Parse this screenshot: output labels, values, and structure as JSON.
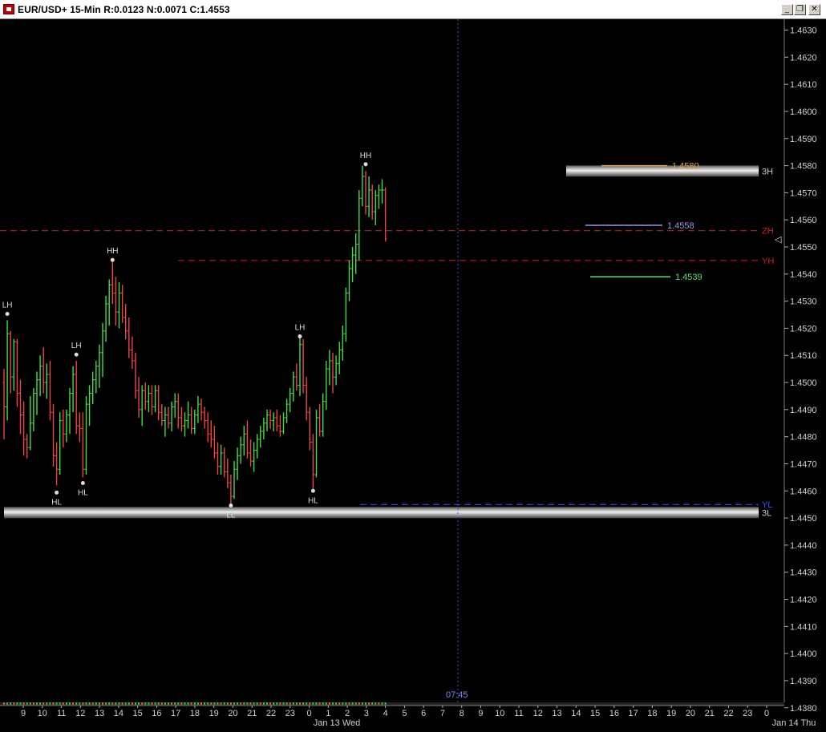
{
  "window": {
    "title": "EUR/USD+ 15-Min R:0.0123 N:0.0071 C:1.4553",
    "minimize_glyph": "_",
    "restore_glyph": "❐",
    "close_glyph": "✕"
  },
  "chart_data": {
    "type": "bar",
    "title": "EUR/USD+ 15-Min R:0.0123 N:0.0071 C:1.4553",
    "bar_style": "OHLC",
    "colors": {
      "up": "#44dd44",
      "down": "#ee4444",
      "background": "#000000",
      "axis_text": "#d0d0d0"
    },
    "ylim": [
      1.4382,
      1.4634
    ],
    "y_ticks": [
      1.463,
      1.462,
      1.461,
      1.46,
      1.459,
      1.458,
      1.457,
      1.456,
      1.455,
      1.454,
      1.453,
      1.452,
      1.451,
      1.45,
      1.449,
      1.448,
      1.447,
      1.446,
      1.445,
      1.444,
      1.443,
      1.442,
      1.441,
      1.44,
      1.439,
      1.438
    ],
    "x_ticks": [
      "9",
      "10",
      "11",
      "12",
      "13",
      "14",
      "15",
      "16",
      "17",
      "18",
      "19",
      "20",
      "21",
      "22",
      "23",
      "0",
      "1",
      "2",
      "3",
      "4",
      "5",
      "6",
      "7",
      "8",
      "9",
      "10",
      "11",
      "12",
      "13",
      "14",
      "15",
      "16",
      "17",
      "18",
      "19",
      "20",
      "21",
      "22",
      "23",
      "0"
    ],
    "x_date_labels": [
      "Jan 13 Wed",
      "Jan 14 Thu"
    ],
    "cursor_time": "07:45",
    "pivot_labels": [
      {
        "text": "LH",
        "bar": 1,
        "price": 1.45253,
        "pos": "above"
      },
      {
        "text": "HL",
        "bar": 16,
        "price": 1.44594,
        "pos": "below"
      },
      {
        "text": "LH",
        "bar": 22,
        "price": 1.45103,
        "pos": "above"
      },
      {
        "text": "HL",
        "bar": 24,
        "price": 1.44629,
        "pos": "below"
      },
      {
        "text": "HH",
        "bar": 33,
        "price": 1.45452,
        "pos": "above"
      },
      {
        "text": "LL",
        "bar": 69,
        "price": 1.44546,
        "pos": "below"
      },
      {
        "text": "LH",
        "bar": 90,
        "price": 1.4517,
        "pos": "above"
      },
      {
        "text": "HL",
        "bar": 94,
        "price": 1.446,
        "pos": "below"
      },
      {
        "text": "HH",
        "bar": 110,
        "price": 1.45805,
        "pos": "above"
      }
    ],
    "levels": [
      {
        "label": "ZH",
        "price": 1.4556,
        "color": "#cc2222",
        "style": "dashed"
      },
      {
        "label": "YH",
        "price": 1.4545,
        "color": "#cc2222",
        "style": "dashed"
      },
      {
        "label": "YL",
        "price": 1.4455,
        "color": "#3355ff",
        "style": "dashed"
      }
    ],
    "bands": [
      {
        "label": "3H",
        "price": 1.4578
      },
      {
        "label": "3L",
        "price": 1.4452
      }
    ],
    "price_markers": [
      {
        "text": "1.4580",
        "price": 1.458,
        "color": "#e0a040"
      },
      {
        "text": "1.4558",
        "price": 1.4558,
        "color": "#9999ee"
      },
      {
        "text": "1.4539",
        "price": 1.4539,
        "color": "#66dd66"
      }
    ],
    "series": [
      {
        "values": [
          [
            1.45,
            1.4505,
            1.4479,
            1.4491
          ],
          [
            1.4491,
            1.4523,
            1.4486,
            1.4518
          ],
          [
            1.4518,
            1.4519,
            1.4496,
            1.4502
          ],
          [
            1.4502,
            1.4516,
            1.4497,
            1.4515
          ],
          [
            1.4515,
            1.4516,
            1.4491,
            1.4496
          ],
          [
            1.4496,
            1.4501,
            1.4481,
            1.4488
          ],
          [
            1.4488,
            1.4493,
            1.4473,
            1.4479
          ],
          [
            1.4479,
            1.4481,
            1.4472,
            1.4476
          ],
          [
            1.4476,
            1.4495,
            1.4475,
            1.4485
          ],
          [
            1.4485,
            1.4498,
            1.4482,
            1.4496
          ],
          [
            1.4496,
            1.4504,
            1.4488,
            1.4501
          ],
          [
            1.4501,
            1.451,
            1.4495,
            1.4506
          ],
          [
            1.4506,
            1.4513,
            1.4496,
            1.45
          ],
          [
            1.45,
            1.4507,
            1.4494,
            1.4503
          ],
          [
            1.4503,
            1.4508,
            1.4486,
            1.4489
          ],
          [
            1.4489,
            1.4492,
            1.4469,
            1.4473
          ],
          [
            1.4473,
            1.4478,
            1.4462,
            1.4468
          ],
          [
            1.4468,
            1.4489,
            1.4466,
            1.4486
          ],
          [
            1.4486,
            1.449,
            1.4476,
            1.4481
          ],
          [
            1.4481,
            1.449,
            1.4478,
            1.4488
          ],
          [
            1.4488,
            1.4498,
            1.4481,
            1.4496
          ],
          [
            1.4496,
            1.4506,
            1.4489,
            1.4503
          ],
          [
            1.4503,
            1.4508,
            1.4481,
            1.4484
          ],
          [
            1.4484,
            1.4489,
            1.4478,
            1.4483
          ],
          [
            1.4483,
            1.4489,
            1.4465,
            1.4468
          ],
          [
            1.4468,
            1.4495,
            1.4466,
            1.4492
          ],
          [
            1.4492,
            1.4499,
            1.4484,
            1.4496
          ],
          [
            1.4496,
            1.4504,
            1.4492,
            1.4501
          ],
          [
            1.4501,
            1.4508,
            1.4496,
            1.4506
          ],
          [
            1.4506,
            1.4514,
            1.4498,
            1.4511
          ],
          [
            1.4511,
            1.4522,
            1.4502,
            1.4519
          ],
          [
            1.4519,
            1.4532,
            1.4515,
            1.4529
          ],
          [
            1.4529,
            1.4538,
            1.4521,
            1.4536
          ],
          [
            1.4536,
            1.4545,
            1.4529,
            1.4533
          ],
          [
            1.4533,
            1.4539,
            1.4521,
            1.4526
          ],
          [
            1.4526,
            1.4537,
            1.452,
            1.4533
          ],
          [
            1.4533,
            1.4536,
            1.4522,
            1.4524
          ],
          [
            1.4524,
            1.4529,
            1.4516,
            1.4519
          ],
          [
            1.4519,
            1.4524,
            1.4509,
            1.4512
          ],
          [
            1.4512,
            1.4517,
            1.4505,
            1.4508
          ],
          [
            1.4508,
            1.4511,
            1.4494,
            1.4497
          ],
          [
            1.4497,
            1.4502,
            1.4487,
            1.449
          ],
          [
            1.449,
            1.4499,
            1.4484,
            1.4497
          ],
          [
            1.4497,
            1.45,
            1.449,
            1.4493
          ],
          [
            1.4493,
            1.4499,
            1.4489,
            1.4496
          ],
          [
            1.4496,
            1.4499,
            1.4488,
            1.4491
          ],
          [
            1.4491,
            1.4499,
            1.4489,
            1.4497
          ],
          [
            1.4497,
            1.4499,
            1.4486,
            1.4489
          ],
          [
            1.4489,
            1.4492,
            1.4484,
            1.4486
          ],
          [
            1.4486,
            1.4491,
            1.448,
            1.4488
          ],
          [
            1.4488,
            1.4491,
            1.4483,
            1.4485
          ],
          [
            1.4485,
            1.4493,
            1.4482,
            1.4491
          ],
          [
            1.4491,
            1.4496,
            1.4487,
            1.4493
          ],
          [
            1.4493,
            1.4496,
            1.4483,
            1.4487
          ],
          [
            1.4487,
            1.4491,
            1.4482,
            1.4484
          ],
          [
            1.4484,
            1.4489,
            1.448,
            1.4486
          ],
          [
            1.4486,
            1.4493,
            1.4483,
            1.4488
          ],
          [
            1.4488,
            1.4491,
            1.4481,
            1.4483
          ],
          [
            1.4483,
            1.449,
            1.4481,
            1.4488
          ],
          [
            1.4488,
            1.4495,
            1.4485,
            1.4492
          ],
          [
            1.4492,
            1.4494,
            1.4486,
            1.4489
          ],
          [
            1.4489,
            1.4491,
            1.4483,
            1.4486
          ],
          [
            1.4486,
            1.4489,
            1.4478,
            1.4481
          ],
          [
            1.4481,
            1.4486,
            1.4476,
            1.4479
          ],
          [
            1.4479,
            1.4484,
            1.4472,
            1.4474
          ],
          [
            1.4474,
            1.4478,
            1.4466,
            1.4469
          ],
          [
            1.4469,
            1.4477,
            1.4466,
            1.4474
          ],
          [
            1.4474,
            1.4476,
            1.4465,
            1.4467
          ],
          [
            1.4467,
            1.4472,
            1.4461,
            1.4463
          ],
          [
            1.4463,
            1.4466,
            1.4455,
            1.4458
          ],
          [
            1.4458,
            1.4471,
            1.4457,
            1.4468
          ],
          [
            1.4468,
            1.4476,
            1.4464,
            1.4473
          ],
          [
            1.4473,
            1.448,
            1.447,
            1.4477
          ],
          [
            1.4477,
            1.4484,
            1.4473,
            1.4481
          ],
          [
            1.4481,
            1.4486,
            1.4472,
            1.4474
          ],
          [
            1.4474,
            1.4479,
            1.4469,
            1.4471
          ],
          [
            1.4471,
            1.4478,
            1.4467,
            1.4475
          ],
          [
            1.4475,
            1.4481,
            1.4472,
            1.4479
          ],
          [
            1.4479,
            1.4484,
            1.4476,
            1.4482
          ],
          [
            1.4482,
            1.4487,
            1.4479,
            1.4485
          ],
          [
            1.4485,
            1.449,
            1.4482,
            1.4488
          ],
          [
            1.4488,
            1.449,
            1.4483,
            1.4486
          ],
          [
            1.4486,
            1.4489,
            1.4482,
            1.4487
          ],
          [
            1.4487,
            1.449,
            1.4482,
            1.4484
          ],
          [
            1.4484,
            1.4488,
            1.448,
            1.4482
          ],
          [
            1.4482,
            1.4489,
            1.4481,
            1.4487
          ],
          [
            1.4487,
            1.4494,
            1.4485,
            1.4492
          ],
          [
            1.4492,
            1.4498,
            1.4489,
            1.4496
          ],
          [
            1.4496,
            1.4504,
            1.4493,
            1.4502
          ],
          [
            1.4502,
            1.4507,
            1.4497,
            1.4499
          ],
          [
            1.4499,
            1.4517,
            1.4495,
            1.4514
          ],
          [
            1.4514,
            1.4516,
            1.4496,
            1.4499
          ],
          [
            1.4499,
            1.4502,
            1.4486,
            1.4489
          ],
          [
            1.4489,
            1.4491,
            1.4475,
            1.4478
          ],
          [
            1.4478,
            1.4481,
            1.446,
            1.4466
          ],
          [
            1.4466,
            1.449,
            1.4465,
            1.4487
          ],
          [
            1.4487,
            1.4492,
            1.448,
            1.4482
          ],
          [
            1.4482,
            1.4496,
            1.448,
            1.4493
          ],
          [
            1.4493,
            1.4508,
            1.449,
            1.4505
          ],
          [
            1.4505,
            1.4512,
            1.4499,
            1.4508
          ],
          [
            1.4508,
            1.4511,
            1.4496,
            1.4502
          ],
          [
            1.4502,
            1.451,
            1.4499,
            1.4507
          ],
          [
            1.4507,
            1.4515,
            1.4503,
            1.4512
          ],
          [
            1.4512,
            1.4521,
            1.4508,
            1.4518
          ],
          [
            1.4518,
            1.4535,
            1.4515,
            1.4533
          ],
          [
            1.4533,
            1.4545,
            1.453,
            1.4542
          ],
          [
            1.4542,
            1.455,
            1.4537,
            1.4547
          ],
          [
            1.4547,
            1.4555,
            1.454,
            1.4551
          ],
          [
            1.4551,
            1.4571,
            1.4545,
            1.4568
          ],
          [
            1.4568,
            1.458,
            1.4565,
            1.4576
          ],
          [
            1.4576,
            1.4578,
            1.4562,
            1.4565
          ],
          [
            1.4565,
            1.4576,
            1.4561,
            1.4571
          ],
          [
            1.4571,
            1.4573,
            1.456,
            1.4563
          ],
          [
            1.4563,
            1.4571,
            1.4558,
            1.4569
          ],
          [
            1.4569,
            1.4573,
            1.4564,
            1.4571
          ],
          [
            1.4571,
            1.4575,
            1.4566,
            1.4571
          ],
          [
            1.4571,
            1.4572,
            1.4552,
            1.4553
          ]
        ]
      }
    ]
  }
}
